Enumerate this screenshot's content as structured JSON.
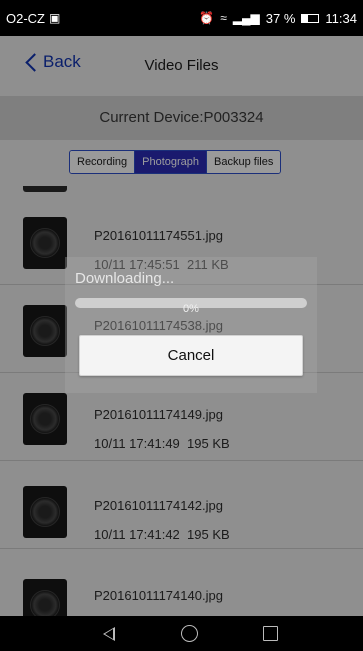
{
  "status_bar": {
    "carrier": "O2-CZ",
    "battery": "37 %",
    "time": "11:34",
    "icons": [
      "image-icon",
      "alarm-icon",
      "wifi-icon",
      "signal-icon",
      "battery-icon"
    ]
  },
  "nav": {
    "back_label": "Back",
    "title": "Video Files"
  },
  "device_label": "Current Device:P003324",
  "tabs": [
    {
      "label": "Recording",
      "active": false
    },
    {
      "label": "Photograph",
      "active": true
    },
    {
      "label": "Backup files",
      "active": false
    }
  ],
  "files": [
    {
      "name": "P20161011174551.jpg",
      "date": "10/11 17:45:51",
      "size": "211 KB"
    },
    {
      "name": "P20161011174538.jpg",
      "date": "",
      "size": ""
    },
    {
      "name": "P20161011174149.jpg",
      "date": "10/11 17:41:49",
      "size": "195 KB"
    },
    {
      "name": "P20161011174142.jpg",
      "date": "10/11 17:41:42",
      "size": "195 KB"
    },
    {
      "name": "P20161011174140.jpg",
      "date": "",
      "size": ""
    }
  ],
  "dialog": {
    "title": "Downloading...",
    "progress_percent": 0,
    "progress_label": "0%",
    "cancel_label": "Cancel"
  },
  "colors": {
    "accent": "#1a1a6e",
    "back_text": "#0a1f6b",
    "progress_fill": "#3b6fd8"
  }
}
